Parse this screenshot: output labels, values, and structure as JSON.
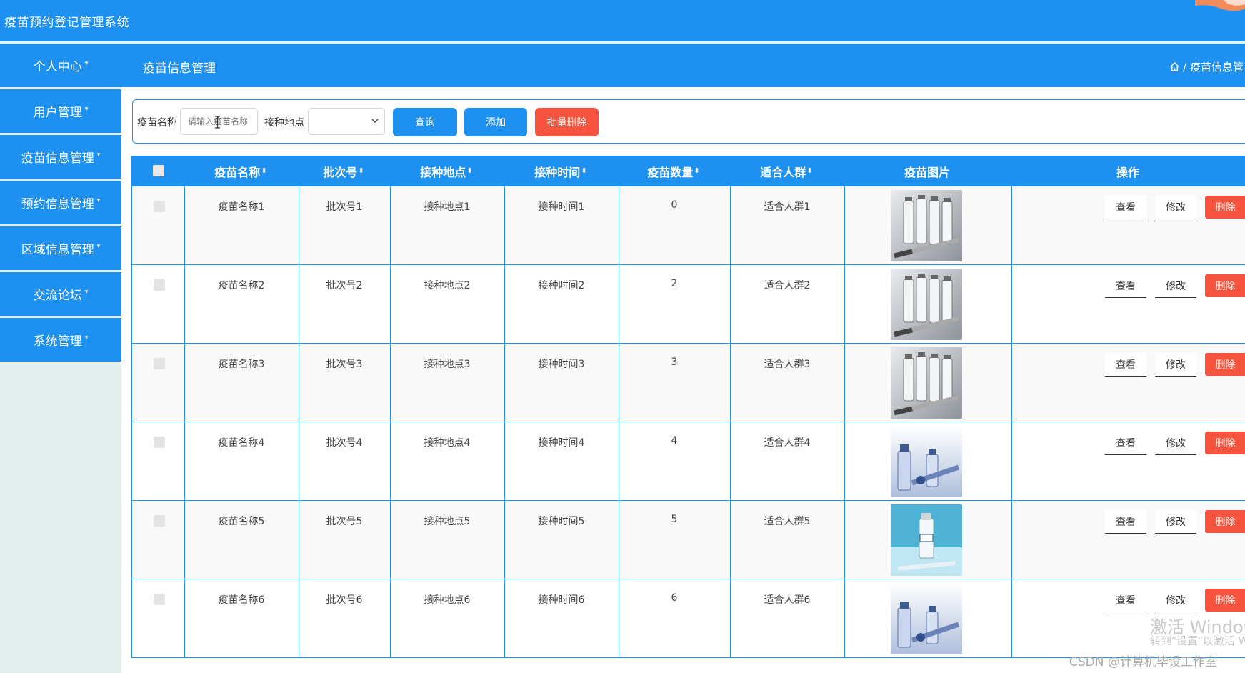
{
  "app": {
    "title": "疫苗预约登记管理系统"
  },
  "sidebar": {
    "items": [
      {
        "label": "个人中心"
      },
      {
        "label": "用户管理"
      },
      {
        "label": "疫苗信息管理"
      },
      {
        "label": "预约信息管理"
      },
      {
        "label": "区域信息管理"
      },
      {
        "label": "交流论坛"
      },
      {
        "label": "系统管理"
      }
    ]
  },
  "header": {
    "title": "疫苗信息管理",
    "breadcrumb": "/ 疫苗信息管"
  },
  "search": {
    "name_label": "疫苗名称",
    "name_placeholder": "请输入疫苗名称",
    "location_label": "接种地点",
    "location_value": "",
    "query_label": "查询",
    "add_label": "添加",
    "batch_delete_label": "批量删除"
  },
  "table": {
    "columns": [
      "疫苗名称",
      "批次号",
      "接种地点",
      "接种时间",
      "疫苗数量",
      "适合人群",
      "疫苗图片",
      "操作"
    ],
    "sort_glyph": "⬍",
    "rows": [
      {
        "name": "疫苗名称1",
        "batch": "批次号1",
        "location": "接种地点1",
        "time": "接种时间1",
        "qty": "0",
        "crowd": "适合人群1",
        "image": "vials-gray"
      },
      {
        "name": "疫苗名称2",
        "batch": "批次号2",
        "location": "接种地点2",
        "time": "接种时间2",
        "qty": "2",
        "crowd": "适合人群2",
        "image": "vials-gray"
      },
      {
        "name": "疫苗名称3",
        "batch": "批次号3",
        "location": "接种地点3",
        "time": "接种时间3",
        "qty": "3",
        "crowd": "适合人群3",
        "image": "vials-gray"
      },
      {
        "name": "疫苗名称4",
        "batch": "批次号4",
        "location": "接种地点4",
        "time": "接种时间4",
        "qty": "4",
        "crowd": "适合人群4",
        "image": "vials-blue"
      },
      {
        "name": "疫苗名称5",
        "batch": "批次号5",
        "location": "接种地点5",
        "time": "接种时间5",
        "qty": "5",
        "crowd": "适合人群5",
        "image": "vial-cyan"
      },
      {
        "name": "疫苗名称6",
        "batch": "批次号6",
        "location": "接种地点6",
        "time": "接种时间6",
        "qty": "6",
        "crowd": "适合人群6",
        "image": "vials-blue"
      }
    ],
    "actions": {
      "view": "查看",
      "edit": "修改",
      "delete": "删除"
    }
  },
  "overlay": {
    "activate_title": "激活 Window",
    "activate_sub": "转到\"设置\"以激活 W",
    "csdn": "CSDN @计算机毕设工作室"
  },
  "colors": {
    "primary": "#1e90f0",
    "danger": "#f5533d",
    "sidebar_bg": "#e3efec"
  }
}
